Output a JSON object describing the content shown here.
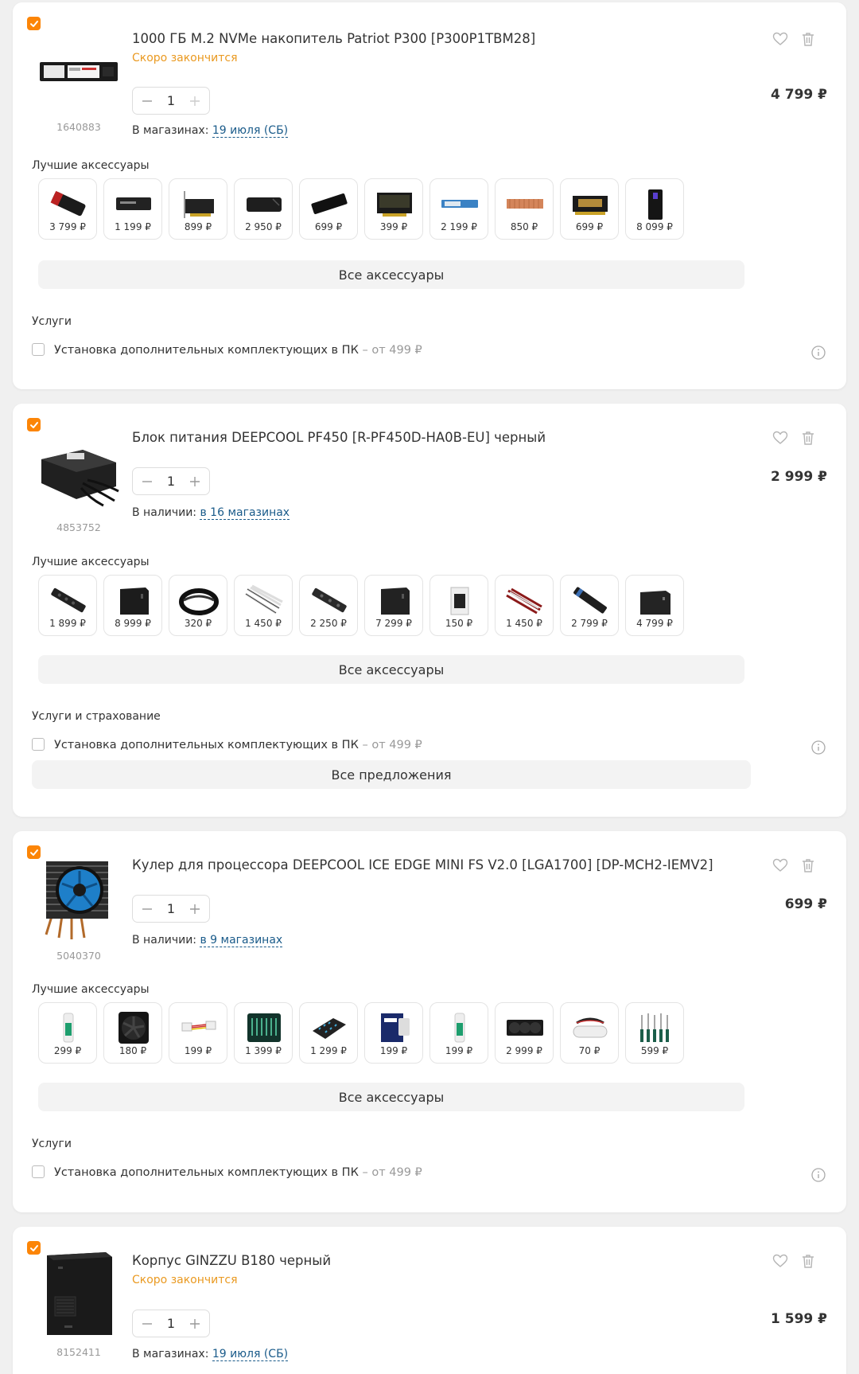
{
  "colors": {
    "accent": "#fc8507",
    "link": "#1a5b8a",
    "warning": "#ea9a22"
  },
  "labels": {
    "accessories": "Лучшие аксессуары",
    "all_accessories": "Все аксессуары",
    "services": "Услуги",
    "services_insurance": "Услуги и страхование",
    "service_name": "Установка дополнительных комплектующих в ПК",
    "service_from": " – от 499 ₽",
    "all_offers": "Все предложения"
  },
  "items": [
    {
      "title": "1000 ГБ M.2 NVMe накопитель Patriot P300 [P300P1TBM28]",
      "status": "Скоро закончится",
      "code": "1640883",
      "qty": "1",
      "avail_prefix": "В магазинах: ",
      "avail_link": "19 июля (СБ)",
      "price": "4 799 ₽",
      "accessories": [
        "3 799 ₽",
        "1 199 ₽",
        "899 ₽",
        "2 950 ₽",
        "699 ₽",
        "399 ₽",
        "2 199 ₽",
        "850 ₽",
        "699 ₽",
        "8 099 ₽"
      ]
    },
    {
      "title": "Блок питания DEEPCOOL PF450 [R-PF450D-HA0B-EU] черный",
      "status": "",
      "code": "4853752",
      "qty": "1",
      "avail_prefix": "В наличии: ",
      "avail_link": "в 16 магазинах",
      "price": "2 999 ₽",
      "accessories": [
        "1 899 ₽",
        "8 999 ₽",
        "320 ₽",
        "1 450 ₽",
        "2 250 ₽",
        "7 299 ₽",
        "150 ₽",
        "1 450 ₽",
        "2 799 ₽",
        "4 799 ₽"
      ]
    },
    {
      "title": "Кулер для процессора DEEPCOOL ICE EDGE MINI FS V2.0 [LGA1700] [DP-MCH2-IEMV2]",
      "status": "",
      "code": "5040370",
      "qty": "1",
      "avail_prefix": "В наличии: ",
      "avail_link": "в 9 магазинах",
      "price": "699 ₽",
      "accessories": [
        "299 ₽",
        "180 ₽",
        "199 ₽",
        "1 399 ₽",
        "1 299 ₽",
        "199 ₽",
        "199 ₽",
        "2 999 ₽",
        "70 ₽",
        "599 ₽"
      ]
    },
    {
      "title": "Корпус GINZZU B180 черный",
      "status": "Скоро закончится",
      "code": "8152411",
      "qty": "1",
      "avail_prefix": "В магазинах: ",
      "avail_link": "19 июля (СБ)",
      "price": "1 599 ₽"
    }
  ]
}
